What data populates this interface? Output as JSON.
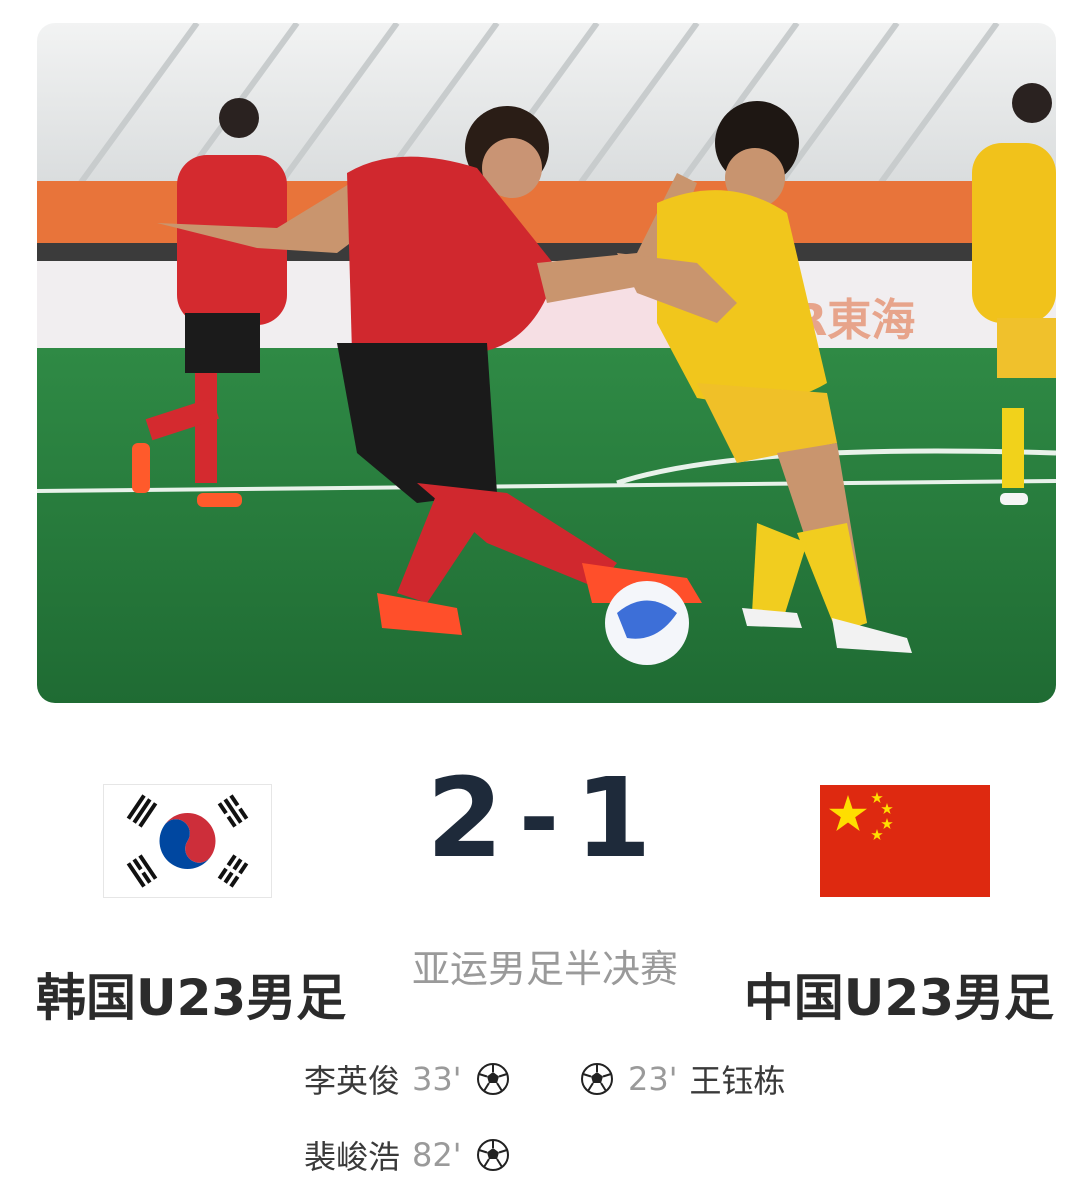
{
  "photo": {
    "alt_icon": "football-match-photo"
  },
  "match": {
    "home_team": "韩国U23男足",
    "away_team": "中国U23男足",
    "home_score": "2",
    "separator": "-",
    "away_score": "1",
    "event": "亚运男足半决赛"
  },
  "scorers": {
    "home": [
      {
        "name": "李英俊",
        "minute": "33'"
      },
      {
        "name": "裴峻浩",
        "minute": "82'"
      }
    ],
    "away": [
      {
        "name": "王钰栋",
        "minute": "23'"
      }
    ]
  },
  "colors": {
    "score_text": "#1e2a3a",
    "kr_red": "#cd2e3a",
    "kr_blue": "#0047a0",
    "cn_red": "#de2910",
    "cn_yellow": "#ffde00"
  },
  "icons": {
    "home_flag": "south-korea-flag-icon",
    "away_flag": "china-flag-icon",
    "goal": "soccer-ball-icon"
  }
}
